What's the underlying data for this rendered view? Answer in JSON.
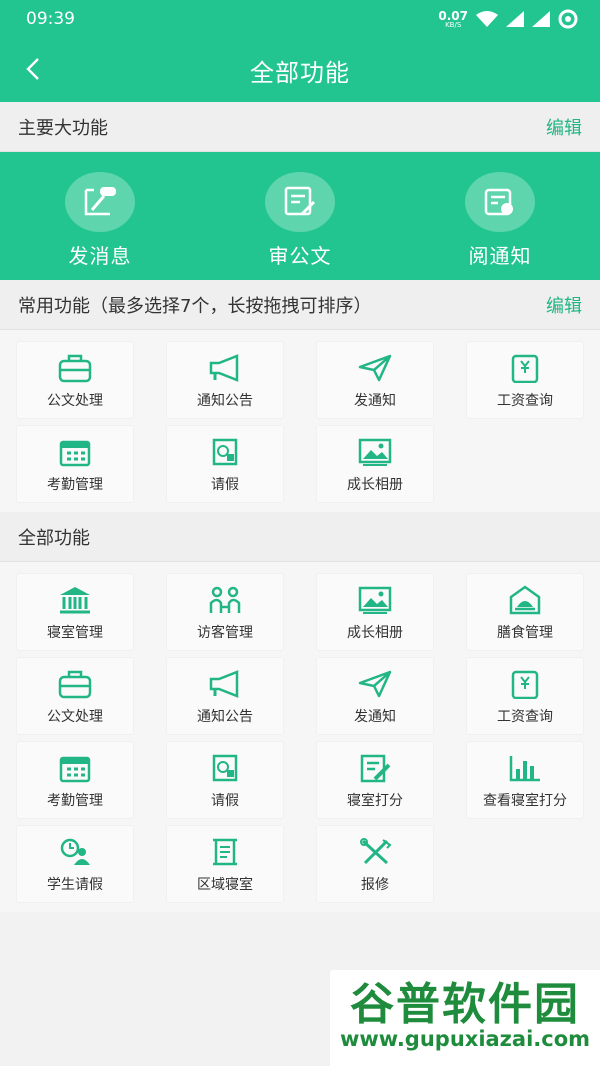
{
  "status": {
    "time": "09:39",
    "net_speed": "0.07",
    "net_unit": "KB/S"
  },
  "header": {
    "title": "全部功能"
  },
  "main_section": {
    "title": "主要大功能",
    "edit": "编辑",
    "items": [
      {
        "label": "发消息",
        "icon": "chat-pen-icon"
      },
      {
        "label": "审公文",
        "icon": "document-edit-icon"
      },
      {
        "label": "阅通知",
        "icon": "notice-icon"
      }
    ]
  },
  "common_section": {
    "title": "常用功能（最多选择7个，长按拖拽可排序）",
    "edit": "编辑",
    "items": [
      {
        "label": "公文处理",
        "icon": "briefcase-icon"
      },
      {
        "label": "通知公告",
        "icon": "megaphone-icon"
      },
      {
        "label": "发通知",
        "icon": "paper-plane-icon"
      },
      {
        "label": "工资查询",
        "icon": "salary-icon"
      },
      {
        "label": "考勤管理",
        "icon": "calendar-icon"
      },
      {
        "label": "请假",
        "icon": "leave-icon"
      },
      {
        "label": "成长相册",
        "icon": "photo-album-icon"
      }
    ]
  },
  "all_section": {
    "title": "全部功能",
    "items": [
      {
        "label": "寝室管理",
        "icon": "building-icon"
      },
      {
        "label": "访客管理",
        "icon": "visitors-icon"
      },
      {
        "label": "成长相册",
        "icon": "photo-album-icon"
      },
      {
        "label": "膳食管理",
        "icon": "meal-icon"
      },
      {
        "label": "公文处理",
        "icon": "briefcase-icon"
      },
      {
        "label": "通知公告",
        "icon": "megaphone-icon"
      },
      {
        "label": "发通知",
        "icon": "paper-plane-icon"
      },
      {
        "label": "工资查询",
        "icon": "salary-icon"
      },
      {
        "label": "考勤管理",
        "icon": "calendar-icon"
      },
      {
        "label": "请假",
        "icon": "leave-icon"
      },
      {
        "label": "寝室打分",
        "icon": "score-edit-icon"
      },
      {
        "label": "查看寝室打分",
        "icon": "bar-chart-icon"
      },
      {
        "label": "学生请假",
        "icon": "student-clock-icon"
      },
      {
        "label": "区域寝室",
        "icon": "scroll-icon"
      },
      {
        "label": "报修",
        "icon": "tools-icon"
      }
    ]
  },
  "watermark": {
    "text": "谷普软件园",
    "url": "www.gupuxiazai.com"
  },
  "colors": {
    "accent": "#22c58f",
    "icon": "#22b585",
    "watermark": "#1e8c3c"
  }
}
